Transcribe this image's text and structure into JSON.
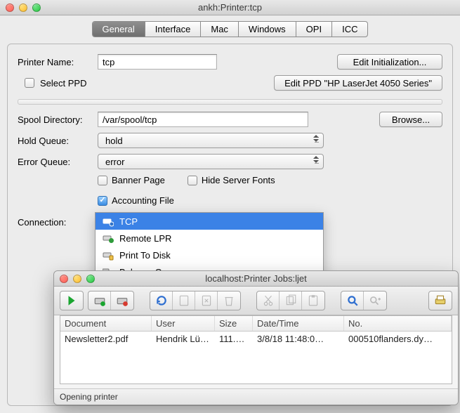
{
  "window_title": "ankh:Printer:tcp",
  "tabs": {
    "general": "General",
    "interface": "Interface",
    "mac": "Mac",
    "windows": "Windows",
    "opi": "OPI",
    "icc": "ICC"
  },
  "labels": {
    "printer_name": "Printer Name:",
    "select_ppd": "Select PPD",
    "edit_init": "Edit Initialization...",
    "edit_ppd": "Edit PPD \"HP LaserJet 4050 Series\"",
    "spool_dir": "Spool Directory:",
    "browse": "Browse...",
    "hold_queue": "Hold Queue:",
    "error_queue": "Error Queue:",
    "banner_page": "Banner Page",
    "hide_fonts": "Hide Server Fonts",
    "accounting": "Accounting File",
    "connection": "Connection:"
  },
  "values": {
    "printer_name": "tcp",
    "spool_dir": "/var/spool/tcp",
    "hold_queue": "hold",
    "error_queue": "error",
    "banner_page": false,
    "hide_fonts": false,
    "accounting": true
  },
  "connection_options": [
    "TCP",
    "Remote LPR",
    "Print To Disk",
    "Balance Group"
  ],
  "connection_selected": "TCP",
  "job_window": {
    "title": "localhost:Printer Jobs:ljet",
    "columns": {
      "doc": "Document",
      "user": "User",
      "size": "Size",
      "dt": "Date/Time",
      "no": "No."
    },
    "rows": [
      {
        "doc": "Newsletter2.pdf",
        "user": "Hendrik Lü…",
        "size": "111.5…",
        "dt": "3/8/18 11:48:0…",
        "no": "000510flanders.dy…"
      }
    ],
    "status": "Opening printer"
  }
}
